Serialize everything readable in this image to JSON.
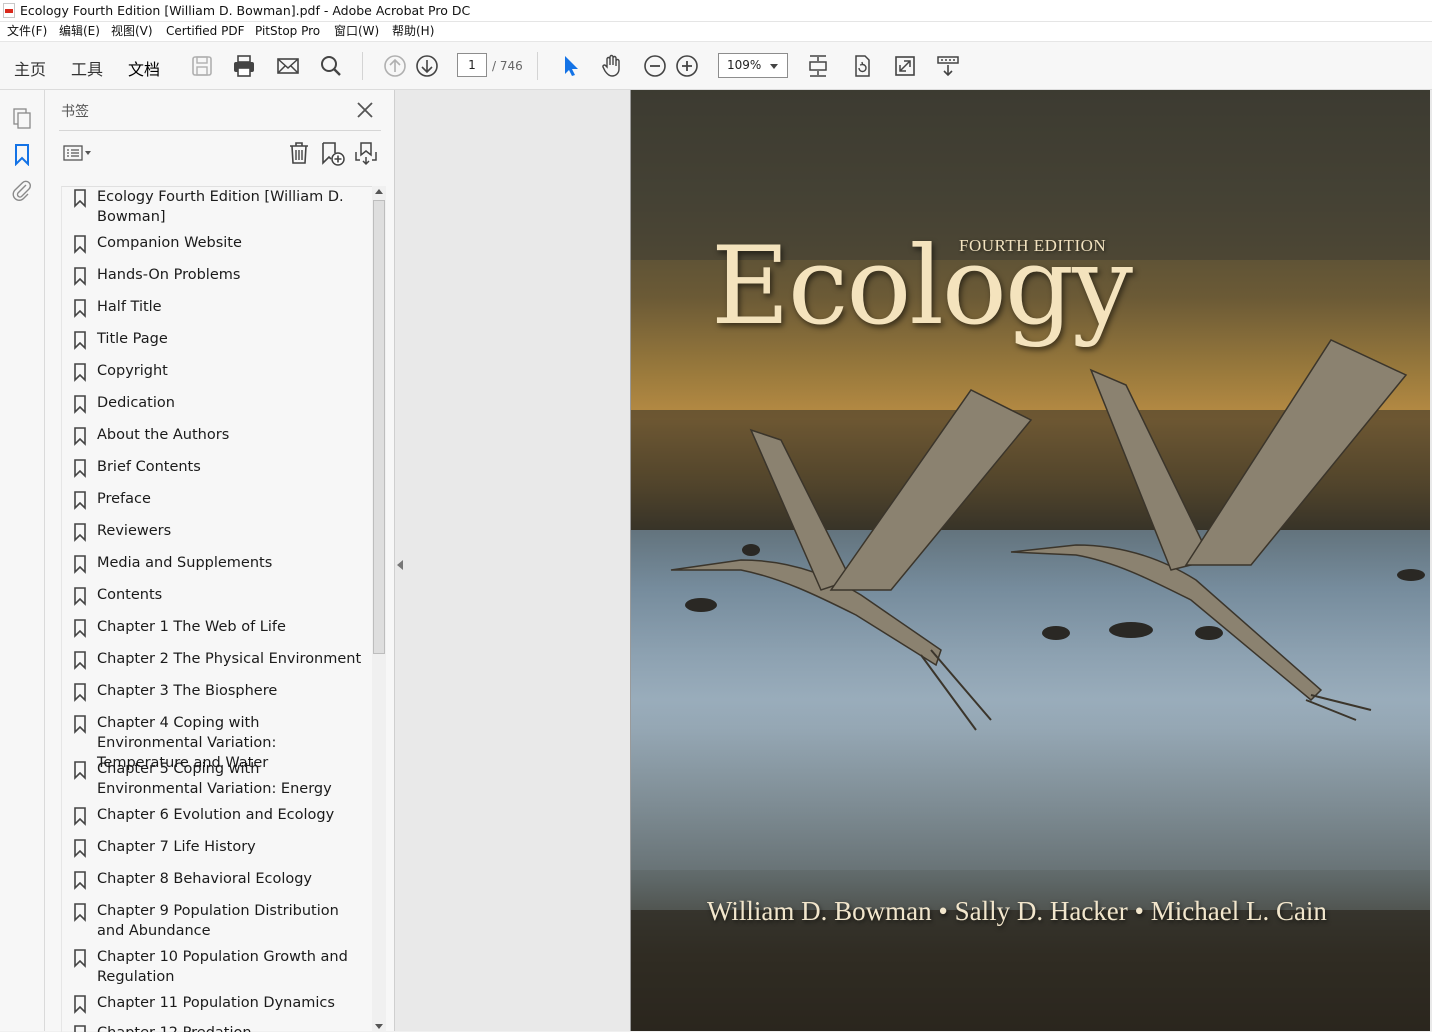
{
  "window": {
    "title": "Ecology Fourth Edition [William D. Bowman].pdf - Adobe Acrobat Pro DC"
  },
  "menu": [
    "文件(F)",
    "编辑(E)",
    "视图(V)",
    "Certified PDF",
    "PitStop Pro",
    "窗口(W)",
    "帮助(H)"
  ],
  "tabs": {
    "home": "主页",
    "tools": "工具",
    "document": "文档"
  },
  "navigation": {
    "current_page": "1",
    "total_pages": "/ 746"
  },
  "zoom": {
    "value": "109%"
  },
  "bookmarks_panel": {
    "title": "书签",
    "items": [
      "Ecology Fourth Edition [William D. Bowman]",
      "Companion Website",
      "Hands-On Problems",
      "Half Title",
      "Title Page",
      "Copyright",
      "Dedication",
      "About the Authors",
      "Brief Contents",
      "Preface",
      "Reviewers",
      "Media and Supplements",
      "Contents",
      "Chapter 1 The Web of Life",
      "Chapter 2 The Physical Environment",
      "Chapter 3 The Biosphere",
      "Chapter 4 Coping with Environmental Variation: Temperature and Water",
      "Chapter 5 Coping with Environmental Variation: Energy",
      "Chapter 6 Evolution and Ecology",
      "Chapter 7 Life History",
      "Chapter 8 Behavioral Ecology",
      "Chapter 9 Population Distribution and Abundance",
      "Chapter 10 Population Growth and Regulation",
      "Chapter 11 Population Dynamics",
      "Chapter 12 Predation"
    ]
  },
  "cover": {
    "title": "Ecology",
    "edition": "FOURTH EDITION",
    "authors": "William D. Bowman • Sally D. Hacker • Michael L. Cain"
  },
  "colors": {
    "accent_blue": "#1473e6",
    "cover_title": "#f4e3bd"
  }
}
